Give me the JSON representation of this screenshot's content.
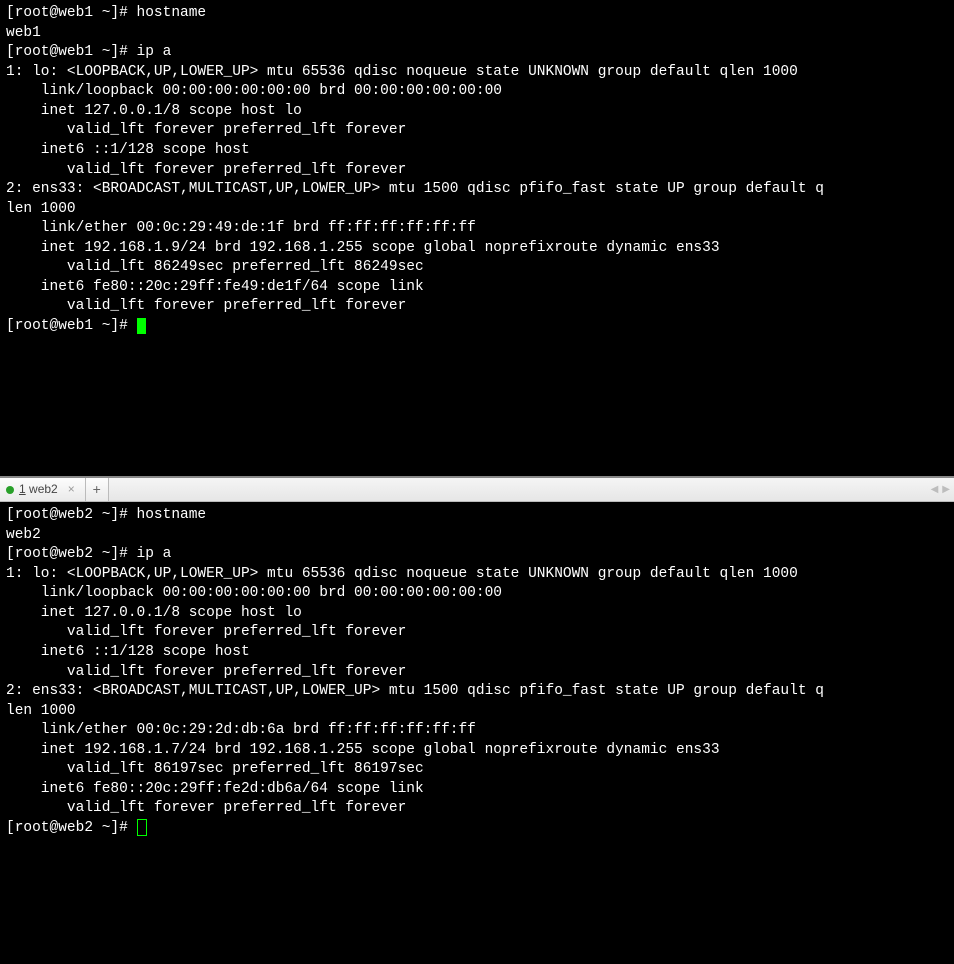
{
  "top": {
    "lines": [
      "[root@web1 ~]# hostname",
      "web1",
      "[root@web1 ~]# ip a",
      "1: lo: <LOOPBACK,UP,LOWER_UP> mtu 65536 qdisc noqueue state UNKNOWN group default qlen 1000",
      "    link/loopback 00:00:00:00:00:00 brd 00:00:00:00:00:00",
      "    inet 127.0.0.1/8 scope host lo",
      "       valid_lft forever preferred_lft forever",
      "    inet6 ::1/128 scope host ",
      "       valid_lft forever preferred_lft forever",
      "2: ens33: <BROADCAST,MULTICAST,UP,LOWER_UP> mtu 1500 qdisc pfifo_fast state UP group default q",
      "len 1000",
      "    link/ether 00:0c:29:49:de:1f brd ff:ff:ff:ff:ff:ff",
      "    inet 192.168.1.9/24 brd 192.168.1.255 scope global noprefixroute dynamic ens33",
      "       valid_lft 86249sec preferred_lft 86249sec",
      "    inet6 fe80::20c:29ff:fe49:de1f/64 scope link ",
      "       valid_lft forever preferred_lft forever"
    ],
    "prompt": "[root@web1 ~]# "
  },
  "tabs": {
    "active": {
      "index": "1",
      "label": "web2"
    },
    "close_glyph": "×",
    "add_glyph": "+",
    "nav_left": "◀",
    "nav_right": "▶"
  },
  "bottom": {
    "lines": [
      "[root@web2 ~]# hostname",
      "web2",
      "[root@web2 ~]# ip a",
      "1: lo: <LOOPBACK,UP,LOWER_UP> mtu 65536 qdisc noqueue state UNKNOWN group default qlen 1000",
      "    link/loopback 00:00:00:00:00:00 brd 00:00:00:00:00:00",
      "    inet 127.0.0.1/8 scope host lo",
      "       valid_lft forever preferred_lft forever",
      "    inet6 ::1/128 scope host ",
      "       valid_lft forever preferred_lft forever",
      "2: ens33: <BROADCAST,MULTICAST,UP,LOWER_UP> mtu 1500 qdisc pfifo_fast state UP group default q",
      "len 1000",
      "    link/ether 00:0c:29:2d:db:6a brd ff:ff:ff:ff:ff:ff",
      "    inet 192.168.1.7/24 brd 192.168.1.255 scope global noprefixroute dynamic ens33",
      "       valid_lft 86197sec preferred_lft 86197sec",
      "    inet6 fe80::20c:29ff:fe2d:db6a/64 scope link ",
      "       valid_lft forever preferred_lft forever"
    ],
    "prompt": "[root@web2 ~]# "
  }
}
